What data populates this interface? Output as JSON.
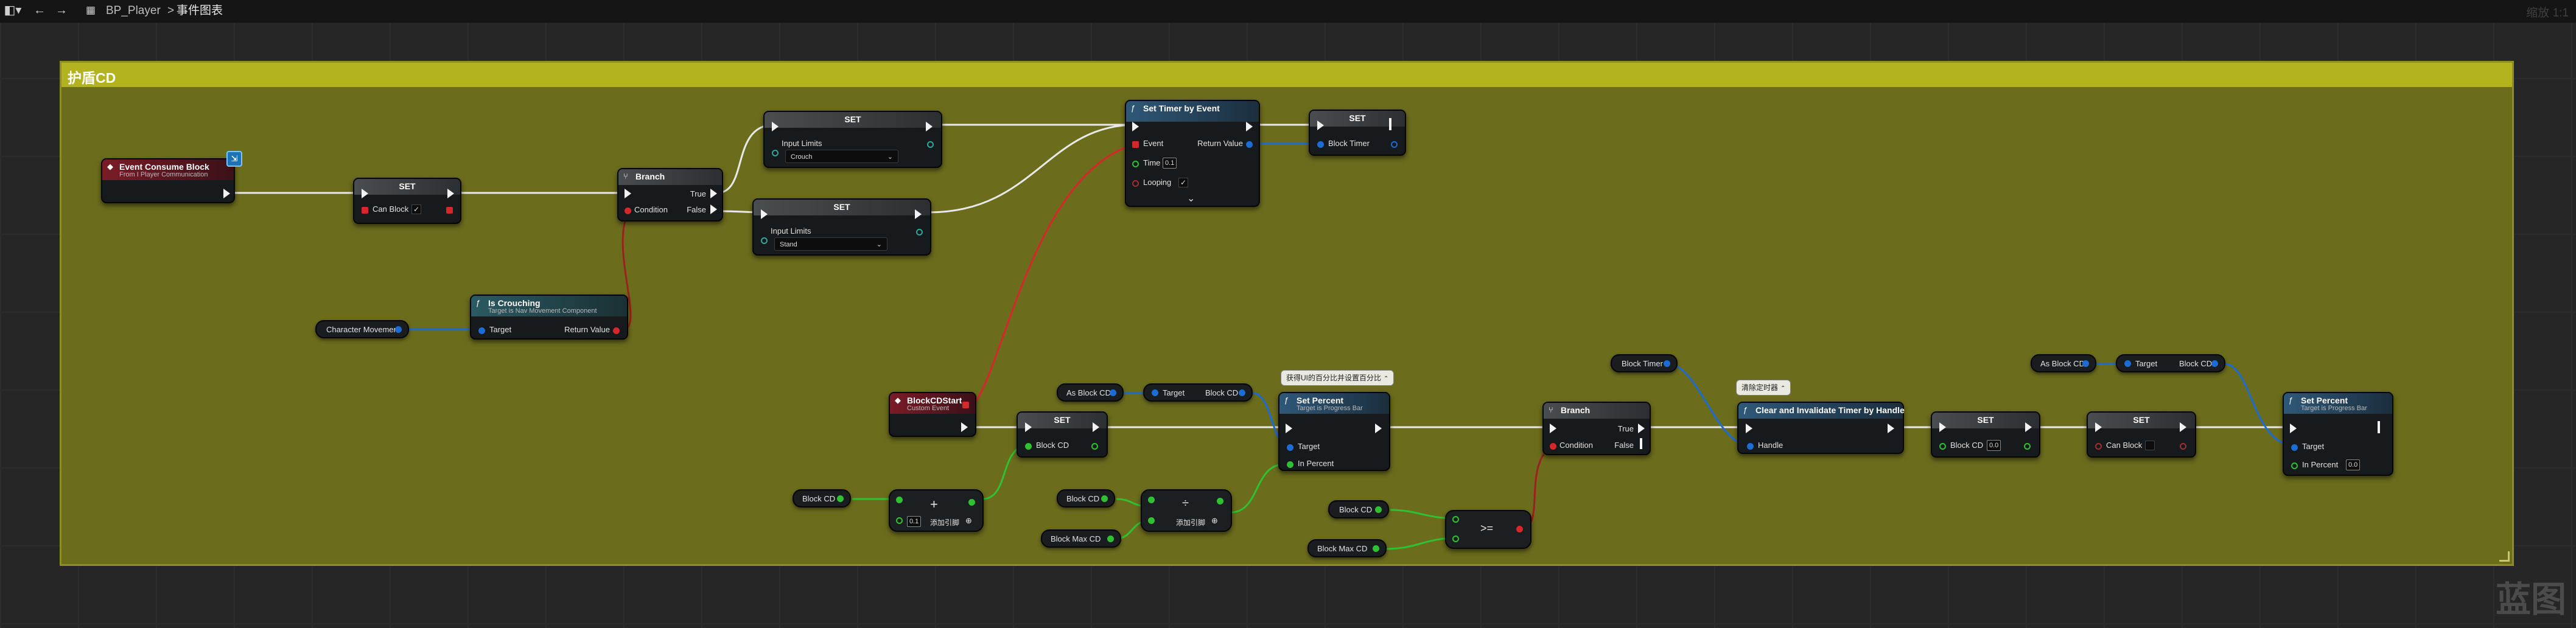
{
  "toolbar": {
    "breadcrumb": [
      "BP_Player",
      "事件图表"
    ],
    "separator": ">",
    "zoom": "缩放 1:1"
  },
  "comment": {
    "title": "护盾CD"
  },
  "watermark": "蓝图",
  "nodes": {
    "event_consume_block": {
      "title": "Event Consume Block",
      "subtitle": "From I Player Communication"
    },
    "set_can_block": {
      "title": "SET",
      "pin_label": "Can Block",
      "check": "✓"
    },
    "branch_1": {
      "title": "Branch",
      "true_label": "True",
      "false_label": "False",
      "condition_label": "Condition"
    },
    "set_crouch": {
      "title": "SET",
      "pin_label": "Input Limits",
      "value": "Crouch"
    },
    "set_stand": {
      "title": "SET",
      "pin_label": "Input Limits",
      "value": "Stand"
    },
    "is_crouching": {
      "title": "Is Crouching",
      "subtitle": "Target is Nav Movement Component",
      "target_label": "Target",
      "return_label": "Return Value"
    },
    "character_movement": {
      "label": "Character Movement"
    },
    "set_timer_by_event": {
      "title": "Set Timer by Event",
      "event_label": "Event",
      "return_label": "Return Value",
      "time_label": "Time",
      "time_value": "0.1",
      "looping_label": "Looping",
      "check": "✓",
      "expand": "⌄"
    },
    "set_block_timer": {
      "title": "SET",
      "pin_label": "Block Timer"
    },
    "block_cd_start": {
      "title": "BlockCDStart",
      "subtitle": "Custom Event"
    },
    "set_block_cd": {
      "title": "SET",
      "pin_label": "Block CD"
    },
    "block_cd_getter_1": {
      "label": "Block CD"
    },
    "add_node_1": {
      "op": "+",
      "value": "0.1",
      "add_pin": "添加引脚"
    },
    "as_block_cd_1": {
      "label": "As Block CD"
    },
    "target_block_cd_1": {
      "target_label": "Target",
      "value_label": "Block CD"
    },
    "block_cd_getter_2": {
      "label": "Block CD"
    },
    "block_max_cd_1": {
      "label": "Block Max CD"
    },
    "divide_node": {
      "op": "÷",
      "add_pin": "添加引脚"
    },
    "comment_bubble_1": {
      "text": "获得UI的百分比并设置百分比",
      "btn": "⌃"
    },
    "set_percent_1": {
      "title": "Set Percent",
      "subtitle": "Target is Progress Bar",
      "target_label": "Target",
      "percent_label": "In Percent"
    },
    "block_cd_getter_3": {
      "label": "Block CD"
    },
    "block_max_cd_2": {
      "label": "Block Max CD"
    },
    "compare_node": {
      "op": ">="
    },
    "branch_2": {
      "title": "Branch",
      "true_label": "True",
      "false_label": "False",
      "condition_label": "Condition"
    },
    "block_timer_getter": {
      "label": "Block Timer"
    },
    "comment_bubble_2": {
      "text": "清除定时器",
      "btn": "⌃"
    },
    "clear_timer": {
      "title": "Clear and Invalidate Timer by Handle",
      "handle_label": "Handle"
    },
    "set_block_cd_zero": {
      "title": "SET",
      "pin_label": "Block CD",
      "value": "0.0"
    },
    "set_can_block_2": {
      "title": "SET",
      "pin_label": "Can Block"
    },
    "as_block_cd_2": {
      "label": "As Block CD"
    },
    "target_block_cd_2": {
      "target_label": "Target",
      "value_label": "Block CD"
    },
    "set_percent_2": {
      "title": "Set Percent",
      "subtitle": "Target is Progress Bar",
      "target_label": "Target",
      "percent_label": "In Percent",
      "percent_value": "0.0"
    }
  }
}
